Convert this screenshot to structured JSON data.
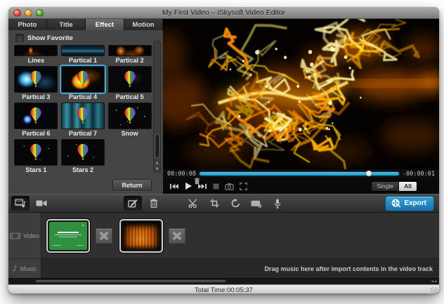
{
  "titlebar": {
    "title": "My First Video – iSkysoft Video Editor"
  },
  "tabs": [
    {
      "label": "Photo",
      "active": false
    },
    {
      "label": "Title",
      "active": false
    },
    {
      "label": "Effect",
      "active": true
    },
    {
      "label": "Motion",
      "active": false
    }
  ],
  "effects_panel": {
    "favorite_label": "Show Favorite",
    "favorite_checked": false,
    "return_label": "Return",
    "items": [
      {
        "name": "Lines",
        "style": "lines",
        "balloon": false,
        "selected": false
      },
      {
        "name": "Partical 1",
        "style": "p1",
        "balloon": false,
        "selected": false
      },
      {
        "name": "Partical 2",
        "style": "p2",
        "balloon": false,
        "selected": false
      },
      {
        "name": "Partical 3",
        "style": "p3",
        "balloon": true,
        "selected": false
      },
      {
        "name": "Partical 4",
        "style": "p4",
        "balloon": true,
        "selected": true
      },
      {
        "name": "Partical 5",
        "style": "p5",
        "balloon": true,
        "selected": false
      },
      {
        "name": "Partical 6",
        "style": "p6",
        "balloon": true,
        "selected": false
      },
      {
        "name": "Partical 7",
        "style": "p7",
        "balloon": true,
        "selected": false
      },
      {
        "name": "Snow",
        "style": "snow",
        "balloon": true,
        "selected": false
      },
      {
        "name": "Stars 1",
        "style": "stars1",
        "balloon": true,
        "selected": false
      },
      {
        "name": "Stars 2",
        "style": "stars2",
        "balloon": true,
        "selected": false
      }
    ]
  },
  "preview": {
    "elapsed": "00:00:08",
    "remaining": "-00:00:01",
    "progress_pct": 85,
    "mode_options": [
      "Single",
      "All"
    ],
    "mode_selected": "All"
  },
  "toolbar": {
    "export_label": "Export"
  },
  "timeline": {
    "video_label": "Video",
    "music_label": "Music",
    "music_hint": "Drag music here after import contents in the video track",
    "clips": [
      {
        "name": "green-title-slide",
        "style": "green"
      },
      {
        "name": "curtain-scene",
        "style": "curtain"
      }
    ]
  },
  "statusbar": {
    "total_time": "Total Time:00:05:37"
  },
  "icons": {
    "music_note": "♪",
    "scroll_up": "▲",
    "scroll_down": "▼",
    "scroll_left": "◄",
    "scroll_right": "►"
  },
  "colors": {
    "accent_blue": "#2ea7d9",
    "export_blue": "#1e7fb6",
    "selection_blue": "#3ba7dd"
  }
}
